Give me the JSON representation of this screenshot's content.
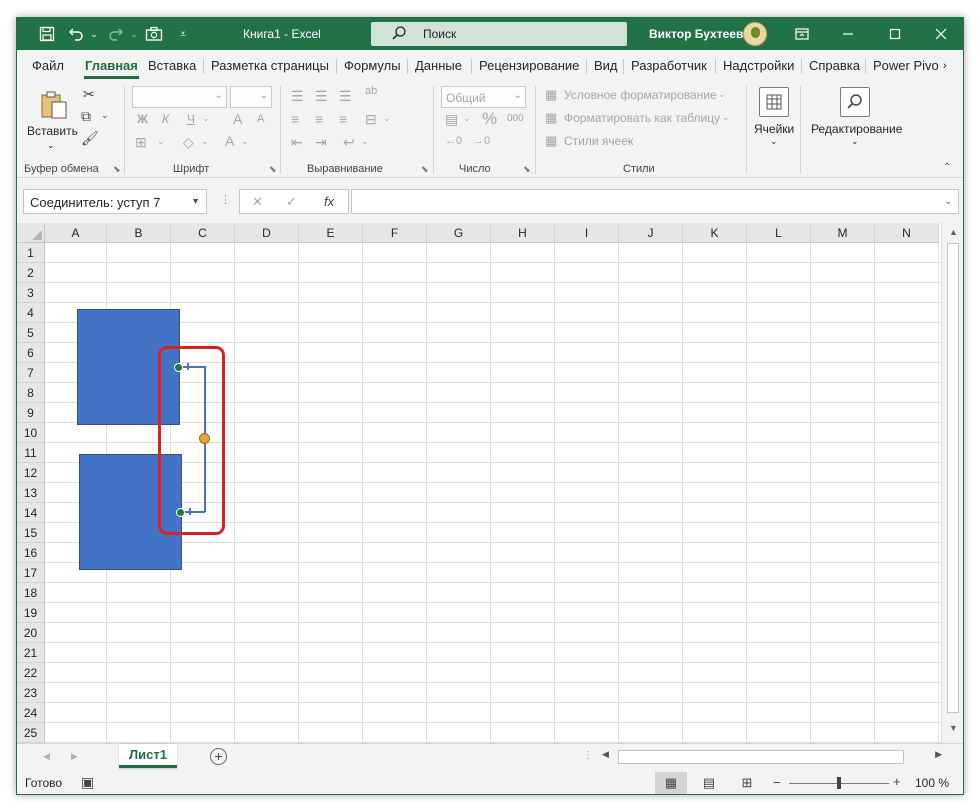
{
  "window": {
    "title": "Книга1  -  Excel",
    "search_label": "Поиск",
    "user_name": "Виктор Бухтеев"
  },
  "tabs": [
    "Файл",
    "Главная",
    "Вставка",
    "Разметка страницы",
    "Формулы",
    "Данные",
    "Рецензирование",
    "Вид",
    "Разработчик",
    "Надстройки",
    "Справка",
    "Power Pivo"
  ],
  "active_tab": "Главная",
  "ribbon": {
    "clipboard": {
      "paste_label": "Вставить",
      "group_label": "Буфер обмена"
    },
    "font": {
      "group_label": "Шрифт",
      "bold": "Ж",
      "italic": "К",
      "underline": "Ч",
      "grow": "A",
      "shrink": "A"
    },
    "alignment": {
      "group_label": "Выравнивание"
    },
    "number": {
      "format_value": "Общий",
      "percent": "%",
      "thousands": "000",
      "group_label": "Число"
    },
    "styles": {
      "conditional": "Условное форматирование",
      "format_table": "Форматировать как таблицу",
      "cell_styles": "Стили ячеек",
      "group_label": "Стили"
    },
    "cells": {
      "label": "Ячейки"
    },
    "editing": {
      "label": "Редактирование"
    }
  },
  "formula_bar": {
    "name_box": "Соединитель: уступ 7",
    "fx": "fx",
    "formula": ""
  },
  "grid": {
    "columns": [
      "A",
      "B",
      "C",
      "D",
      "E",
      "F",
      "G",
      "H",
      "I",
      "J",
      "K",
      "L",
      "M",
      "N"
    ],
    "rows": [
      "1",
      "2",
      "3",
      "4",
      "5",
      "6",
      "7",
      "8",
      "9",
      "10",
      "11",
      "12",
      "13",
      "14",
      "15",
      "16",
      "17",
      "18",
      "19",
      "20",
      "21",
      "22",
      "23",
      "24",
      "25"
    ]
  },
  "sheet_tabs": [
    "Лист1"
  ],
  "status": {
    "ready": "Готово",
    "zoom": "100 %"
  },
  "colors": {
    "excel_green": "#217346",
    "shape_fill": "#4472c4",
    "highlight": "#e02020"
  }
}
